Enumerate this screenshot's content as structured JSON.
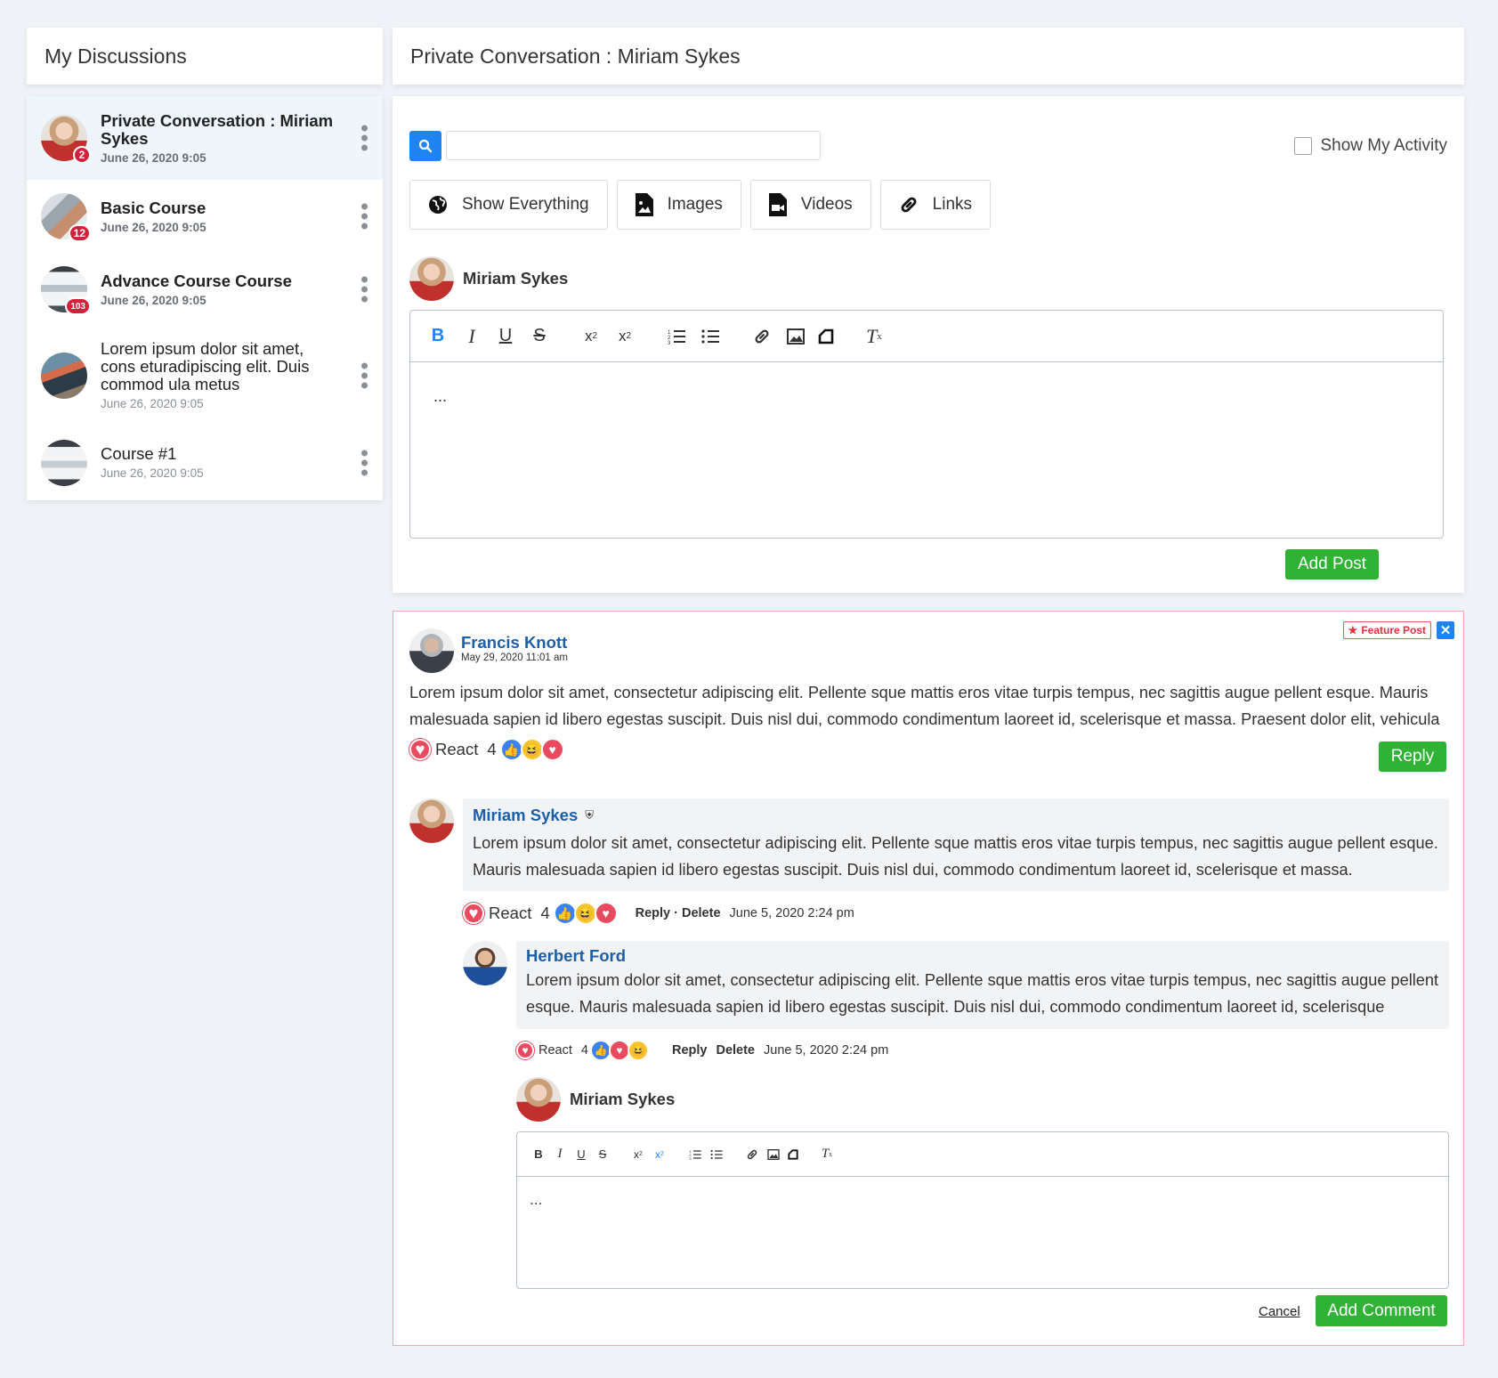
{
  "left_title": "My Discussions",
  "right_title": "Private Conversation : Miriam Sykes",
  "discussions": [
    {
      "title": "Private Conversation : Miriam Sykes",
      "date": "June 26, 2020 9:05",
      "badge": "2",
      "bold": true
    },
    {
      "title": "Basic Course",
      "date": "June 26, 2020 9:05",
      "badge": "12",
      "bold": true
    },
    {
      "title": "Advance Course Course",
      "date": "June 26, 2020 9:05",
      "badge": "103",
      "bold": true
    },
    {
      "title": "Lorem ipsum dolor sit amet, cons eturadipiscing elit. Duis commod ula metus",
      "date": "June 26, 2020 9:05",
      "badge": "",
      "bold": false
    },
    {
      "title": "Course #1",
      "date": "June 26, 2020 9:05",
      "badge": "",
      "bold": false
    }
  ],
  "search": {
    "placeholder": "",
    "value": ""
  },
  "show_activity_label": "Show My Activity",
  "filters": [
    "Show Everything",
    "Images",
    "Videos",
    "Links"
  ],
  "composer": {
    "user": "Miriam Sykes",
    "body": "...",
    "submit": "Add Post"
  },
  "post": {
    "feature_label": "Feature Post",
    "close": "✕",
    "author": "Francis Knott",
    "date": "May 29, 2020 11:01 am",
    "text": "Lorem ipsum dolor sit amet, consectetur adipiscing elit. Pellente sque mattis eros vitae turpis tempus, nec sagittis augue pellent esque. Mauris malesuada sapien id libero egestas suscipit. Duis nisl dui, commodo condimentum laoreet id, scelerisque et massa. Praesent dolor elit, vehicula",
    "react_label": "React",
    "react_count": "4",
    "reply_label": "Reply"
  },
  "comment1": {
    "author": "Miriam Sykes",
    "text": "Lorem ipsum dolor sit amet, consectetur adipiscing elit. Pellente sque mattis eros vitae turpis tempus, nec sagittis augue pellent esque. Mauris malesuada sapien id libero egestas suscipit. Duis nisl dui, commodo condimentum laoreet id, scelerisque et massa.",
    "react_label": "React",
    "react_count": "4",
    "actions": "Reply · Delete",
    "date": "June 5, 2020 2:24 pm"
  },
  "comment2": {
    "author": "Herbert Ford",
    "text": "Lorem ipsum dolor sit amet, consectetur adipiscing elit. Pellente sque mattis eros vitae turpis tempus, nec sagittis augue pellent esque. Mauris malesuada sapien id libero egestas suscipit. Duis nisl dui, commodo condimentum laoreet id, scelerisque",
    "react_label": "React",
    "react_count": "4",
    "reply": "Reply",
    "delete": "Delete",
    "date": "June 5, 2020 2:24 pm"
  },
  "reply_composer": {
    "user": "Miriam Sykes",
    "body": "...",
    "cancel": "Cancel",
    "submit": "Add Comment"
  },
  "colors": {
    "accent": "#1f83f2",
    "green": "#2fb335",
    "name_blue": "#1a5fa8",
    "badge_red": "#d3213b",
    "feature_border": "#f0a8ae"
  }
}
